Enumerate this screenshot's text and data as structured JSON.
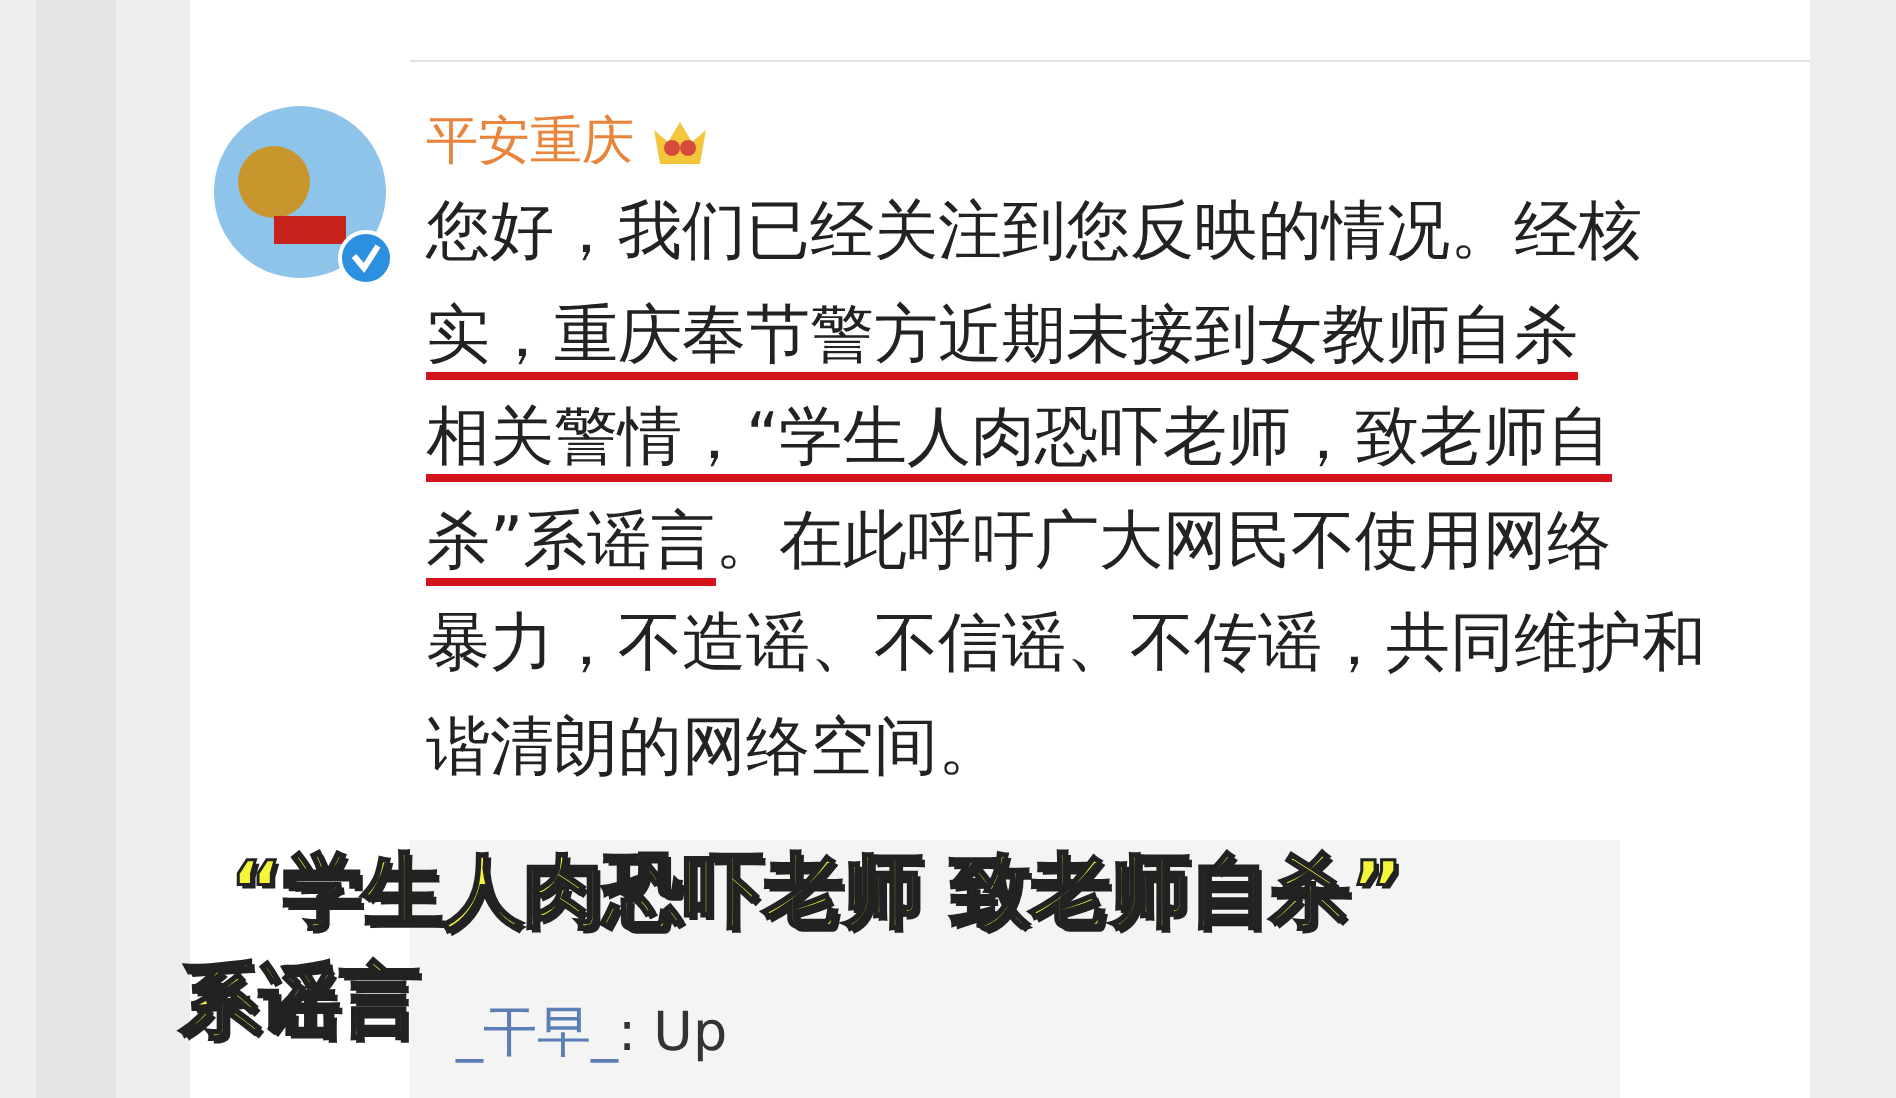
{
  "post": {
    "author": "平安重庆",
    "verified": true,
    "lines": [
      [
        {
          "text": "您好，我们已经关注到您反映的情况。经核",
          "underlined": false
        }
      ],
      [
        {
          "text": "实，重庆奉节警方近期未接到女教师自杀",
          "underlined": true
        }
      ],
      [
        {
          "text": "相关警情，“学生人肉恐吓老师，致老师自",
          "underlined": true
        }
      ],
      [
        {
          "text": "杀”系谣言",
          "underlined": true
        },
        {
          "text": "。在此呼吁广大网民不使用网络",
          "underlined": false
        }
      ],
      [
        {
          "text": "暴力，不造谣、不信谣、不传谣，共同维护和",
          "underlined": false
        }
      ],
      [
        {
          "text": "谐清朗的网络空间。",
          "underlined": false
        }
      ]
    ]
  },
  "comments": [
    {
      "user": "_干早_",
      "text": ": Up"
    }
  ],
  "caption": [
    "“学生人肉恐吓老师 致老师自杀”",
    "系谣言"
  ]
}
